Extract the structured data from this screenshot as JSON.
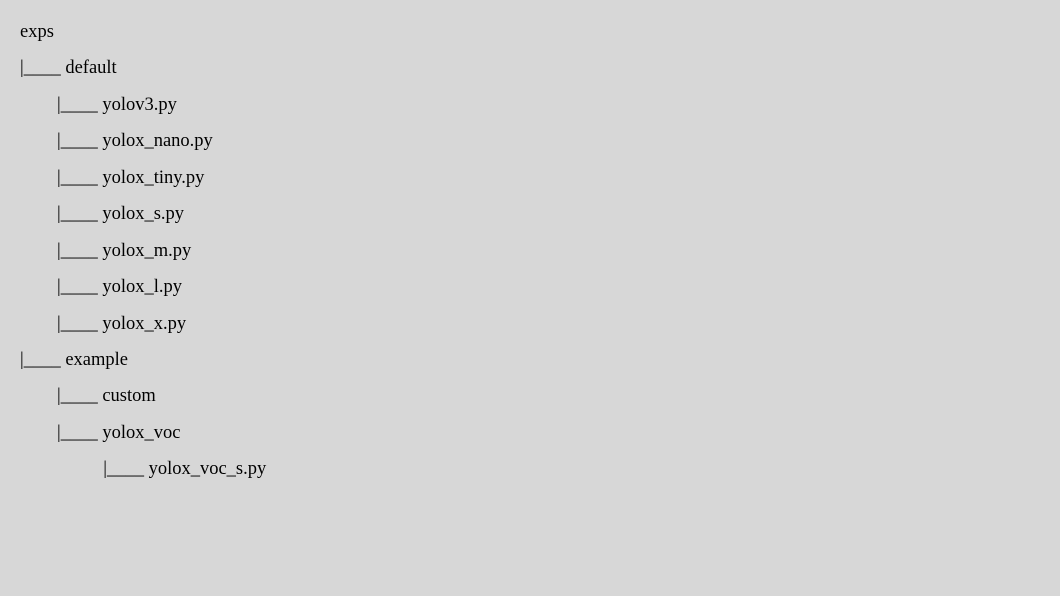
{
  "tree": {
    "lines": [
      "exps",
      "|____ default",
      "        |____ yolov3.py",
      "        |____ yolox_nano.py",
      "        |____ yolox_tiny.py",
      "        |____ yolox_s.py",
      "        |____ yolox_m.py",
      "        |____ yolox_l.py",
      "        |____ yolox_x.py",
      "|____ example",
      "        |____ custom",
      "        |____ yolox_voc",
      "                  |____ yolox_voc_s.py"
    ]
  }
}
